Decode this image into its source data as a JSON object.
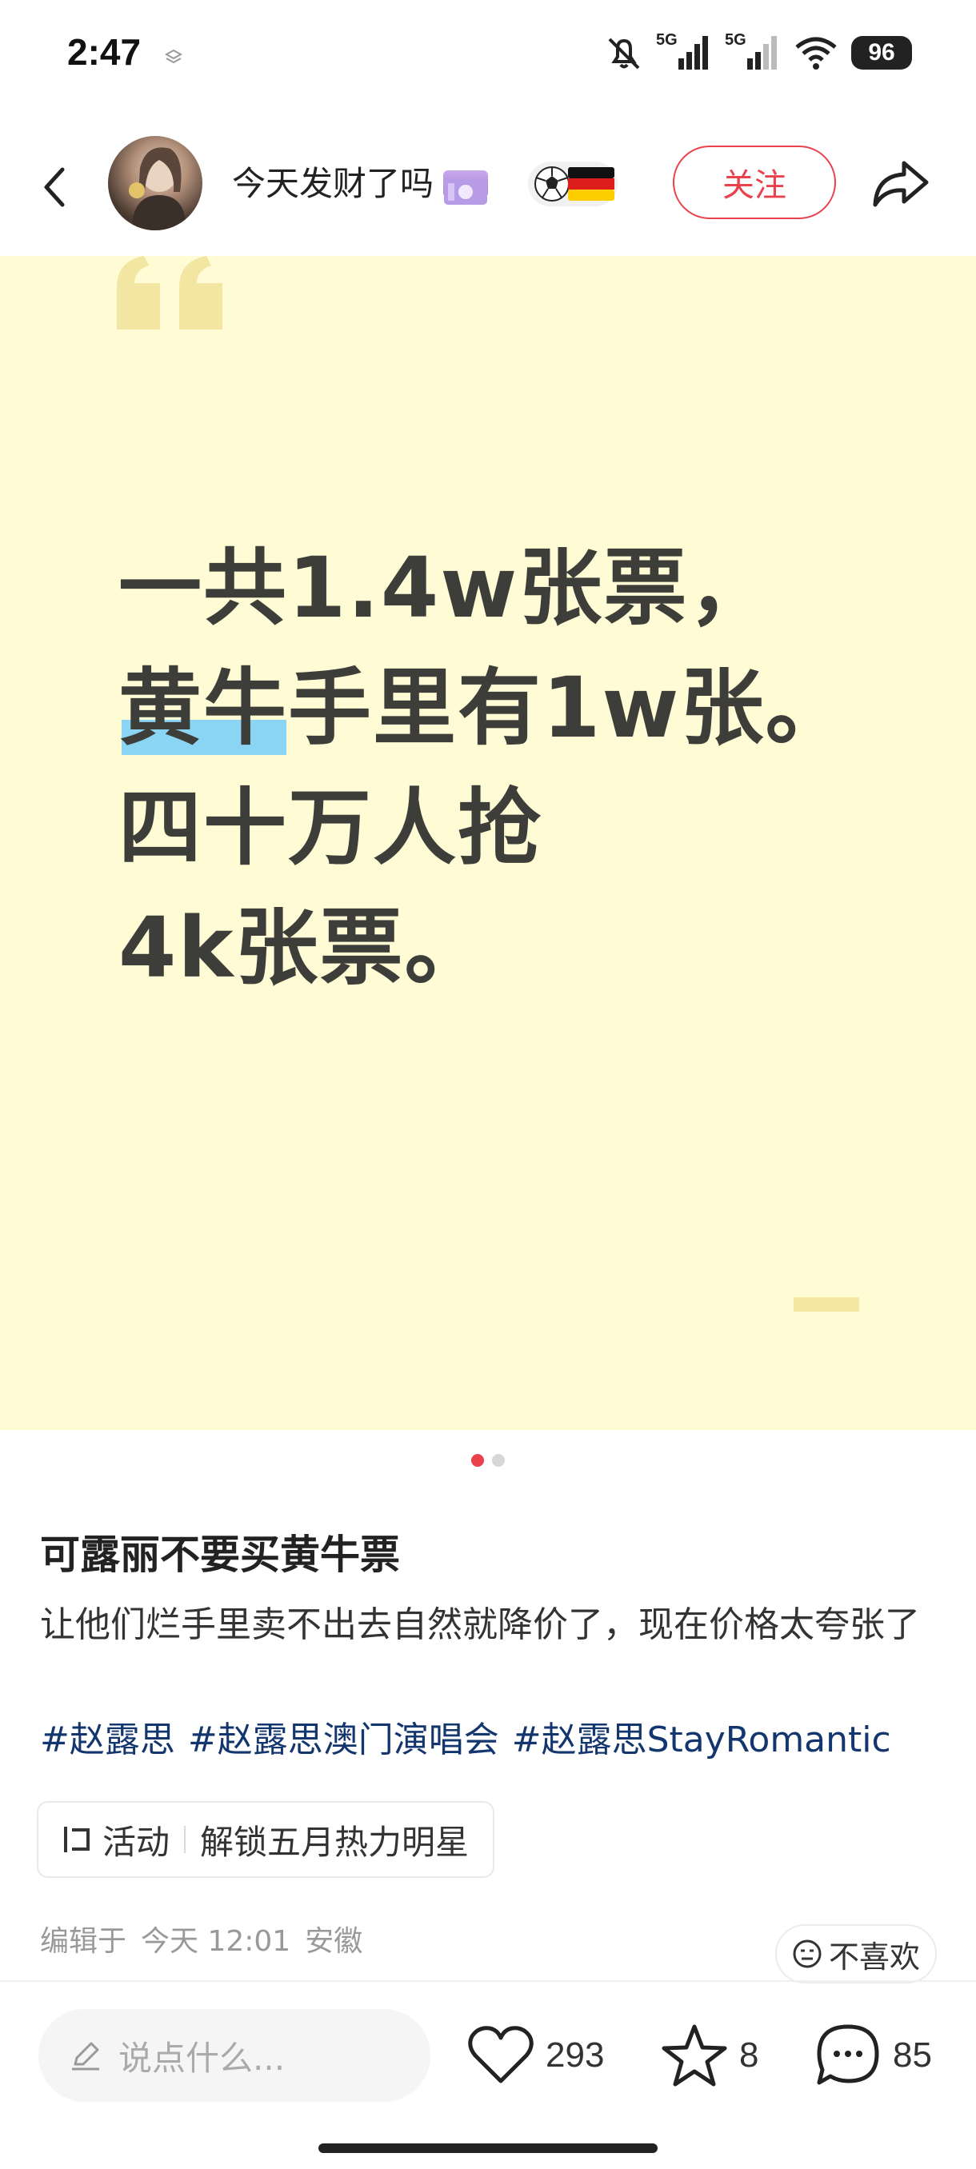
{
  "status_bar": {
    "time": "2:47",
    "network_1": "5G",
    "network_2": "5G",
    "battery": "96"
  },
  "header": {
    "author_name": "今天发财了吗",
    "follow_label": "关注"
  },
  "note_image": {
    "lines": [
      "一共1.4w张票，",
      "黄牛手里有1w张。",
      "四十万人抢",
      "4k张票。"
    ],
    "highlight_color": "#8ad4f4",
    "background_color": "#fffcd5",
    "page_count": 2,
    "current_page": 1
  },
  "note": {
    "title": "可露丽不要买黄牛票",
    "description": "让他们烂手里卖不出去自然就降价了，现在价格太夸张了",
    "hashtags": [
      "#赵露思",
      "#赵露思澳门演唱会",
      "#赵露思StayRomantic"
    ],
    "activity_label": "活动",
    "activity_text": "解锁五月热力明星",
    "edited_prefix": "编辑于",
    "edited_time": "今天 12:01",
    "location": "安徽",
    "dislike_label": "不喜欢"
  },
  "bottom_bar": {
    "comment_placeholder": "说点什么...",
    "likes": "293",
    "favorites": "8",
    "comments": "85"
  },
  "colors": {
    "accent": "#e9424d",
    "hashtag": "#12366d"
  }
}
